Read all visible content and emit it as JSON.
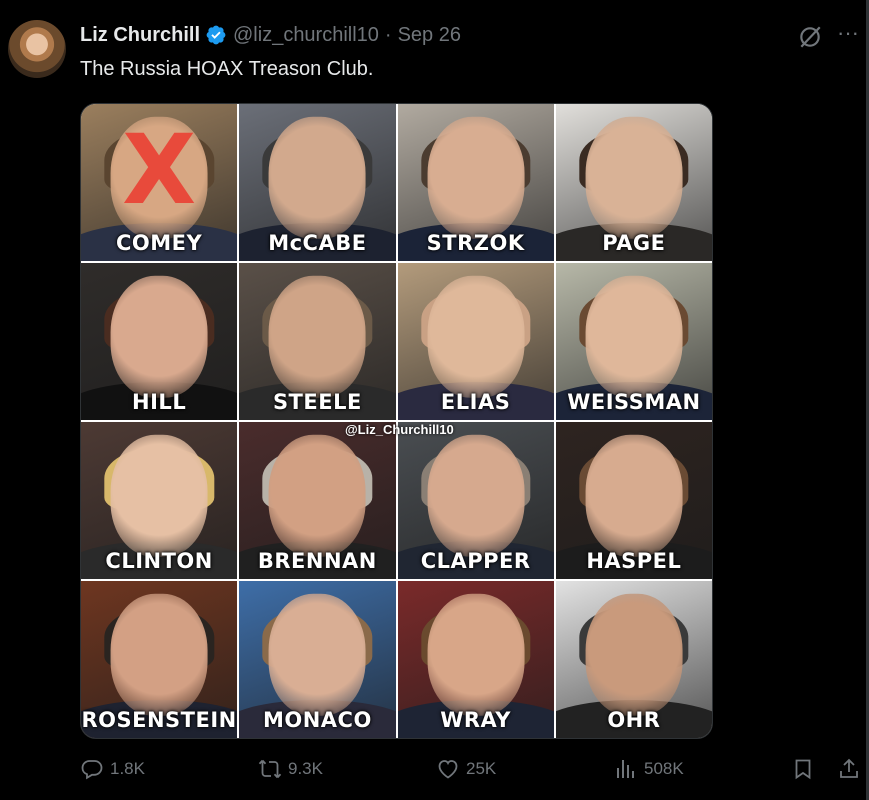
{
  "tweet": {
    "author": {
      "display_name": "Liz Churchill",
      "handle": "@liz_churchill10",
      "verified_icon": "verified-badge-icon"
    },
    "separator": "·",
    "timestamp": "Sep 26",
    "text": "The Russia HOAX Treason Club.",
    "more_label": "···"
  },
  "media": {
    "watermark": "@Liz_Churchill10",
    "crossed_mark": "X",
    "cells": [
      {
        "name": "COMEY",
        "bg": "#9b7f5e",
        "skin": "#d7a783",
        "hair": "#5a4530",
        "body": "#2a3145"
      },
      {
        "name": "McCABE",
        "bg": "#6b6f78",
        "skin": "#d2a98d",
        "hair": "#3a3a3a",
        "body": "#1d2230"
      },
      {
        "name": "STRZOK",
        "bg": "#b1aaa0",
        "skin": "#d8ad91",
        "hair": "#4b3c30",
        "body": "#1b2337"
      },
      {
        "name": "PAGE",
        "bg": "#e1dfdb",
        "skin": "#d9b296",
        "hair": "#3a2b22",
        "body": "#2a2826"
      },
      {
        "name": "HILL",
        "bg": "#2f2c2a",
        "skin": "#d9a98e",
        "hair": "#4a2c20",
        "body": "#111"
      },
      {
        "name": "STEELE",
        "bg": "#5a5048",
        "skin": "#cfa487",
        "hair": "#6b5a48",
        "body": "#2a2a2a"
      },
      {
        "name": "ELIAS",
        "bg": "#b39b7c",
        "skin": "#dfb89a",
        "hair": "#c9a184",
        "body": "#2a2a40"
      },
      {
        "name": "WEISSMAN",
        "bg": "#b7b8a8",
        "skin": "#dfb79a",
        "hair": "#6a4a32",
        "body": "#1c2438"
      },
      {
        "name": "CLINTON",
        "bg": "#4d3a34",
        "skin": "#e6c0a4",
        "hair": "#d8b86a",
        "body": "#2a2a2a"
      },
      {
        "name": "BRENNAN",
        "bg": "#4a2c2c",
        "skin": "#d2a083",
        "hair": "#b8b2a8",
        "body": "#202020"
      },
      {
        "name": "CLAPPER",
        "bg": "#4a4e52",
        "skin": "#d6a98e",
        "hair": "#8a7f74",
        "body": "#202632"
      },
      {
        "name": "HASPEL",
        "bg": "#2e2420",
        "skin": "#d7ab8f",
        "hair": "#6a4b34",
        "body": "#1c1c1c"
      },
      {
        "name": "ROSENSTEIN",
        "bg": "#6e3620",
        "skin": "#d3a084",
        "hair": "#2a2420",
        "body": "#1e2230"
      },
      {
        "name": "MONACO",
        "bg": "#3e6ea8",
        "skin": "#d9ae94",
        "hair": "#8a6a4a",
        "body": "#2a2a3a"
      },
      {
        "name": "WRAY",
        "bg": "#7a2a2a",
        "skin": "#d8a688",
        "hair": "#6a4a2e",
        "body": "#1e2434"
      },
      {
        "name": "OHR",
        "bg": "#e2e2e2",
        "skin": "#c99a7c",
        "hair": "#3a3a3a",
        "body": "#222"
      }
    ]
  },
  "actions": {
    "reply": {
      "count": "1.8K",
      "icon": "reply-icon"
    },
    "retweet": {
      "count": "9.3K",
      "icon": "retweet-icon"
    },
    "like": {
      "count": "25K",
      "icon": "heart-icon"
    },
    "views": {
      "count": "508K",
      "icon": "views-icon"
    },
    "bookmark": {
      "icon": "bookmark-icon"
    },
    "share": {
      "icon": "share-icon"
    }
  },
  "colors": {
    "background": "#000000",
    "text_primary": "#e7e9ea",
    "text_secondary": "#71767b",
    "verified_blue": "#1d9bf0",
    "strike_red": "#e84a3b"
  }
}
